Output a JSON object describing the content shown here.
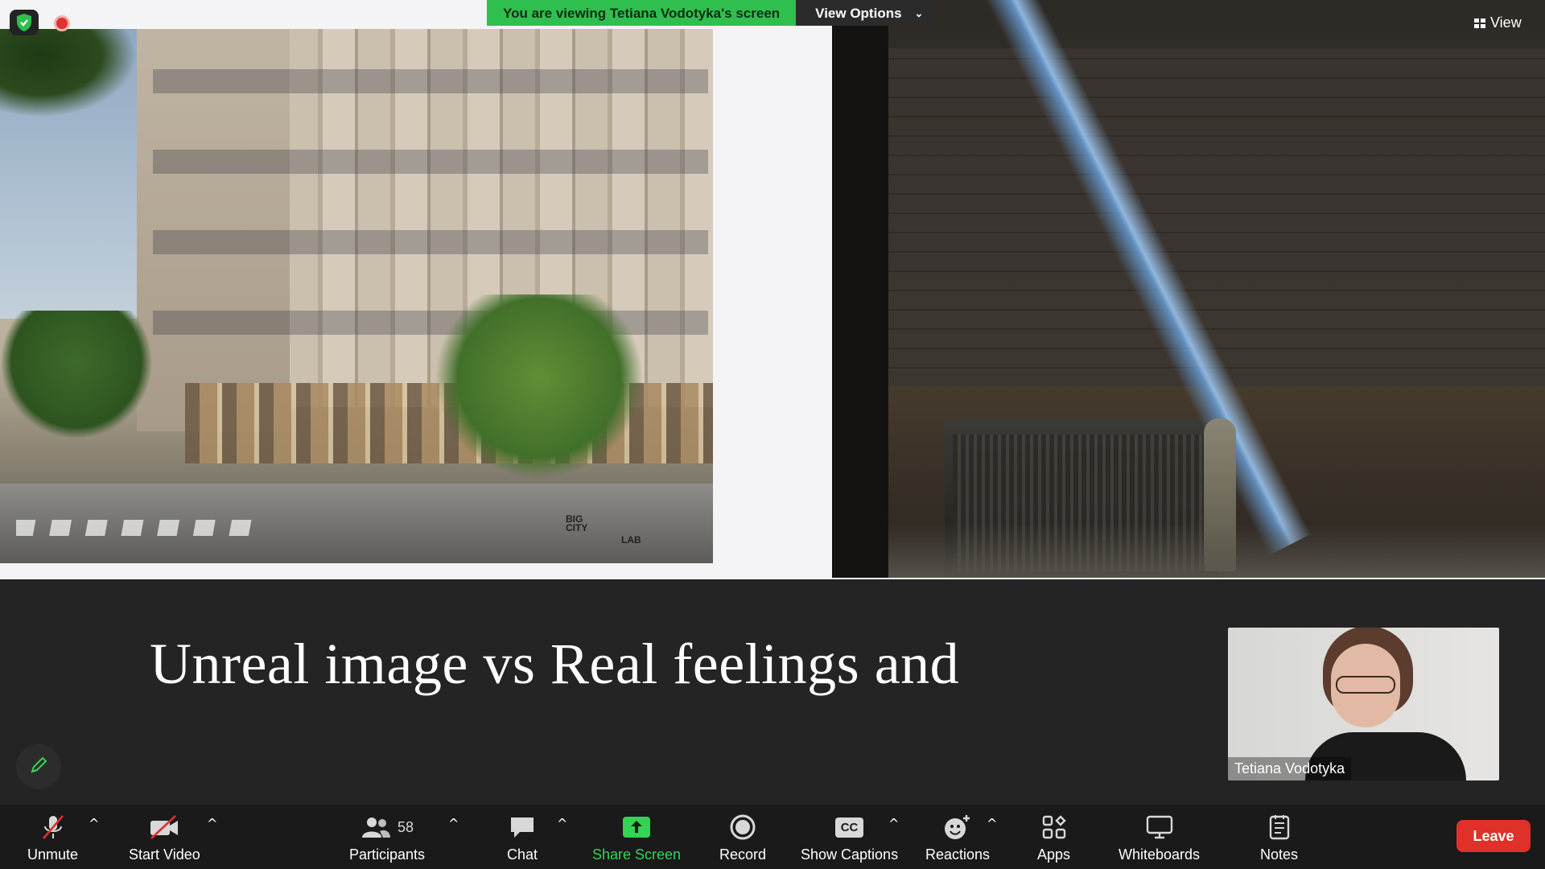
{
  "banner": {
    "viewing_text": "You are viewing Tetiana Vodotyka's screen",
    "options_label": "View Options",
    "options_chevron": "⌄"
  },
  "view": {
    "label": "View"
  },
  "slide": {
    "title": "Unreal image vs Real feelings and",
    "left_image_watermark_line1": "BIG",
    "left_image_watermark_line2": "CITY",
    "left_image_watermark_line3": "LAB"
  },
  "self_video": {
    "name": "Tetiana Vodotyka"
  },
  "toolbar": {
    "unmute": "Unmute",
    "start_video": "Start Video",
    "participants": "Participants",
    "participants_count": "58",
    "chat": "Chat",
    "share_screen": "Share Screen",
    "record": "Record",
    "show_captions": "Show Captions",
    "captions_icon_text": "CC",
    "reactions": "Reactions",
    "apps": "Apps",
    "whiteboards": "Whiteboards",
    "notes": "Notes",
    "leave": "Leave",
    "caret": "^"
  },
  "colors": {
    "accent_green": "#2fbf4e",
    "leave_red": "#e0302a",
    "toolbar_bg": "#1a1a1a"
  },
  "icons": {
    "security": "shield-check-icon",
    "recording": "recording-dot-icon",
    "pen": "pen-icon",
    "view": "grid-icon"
  }
}
